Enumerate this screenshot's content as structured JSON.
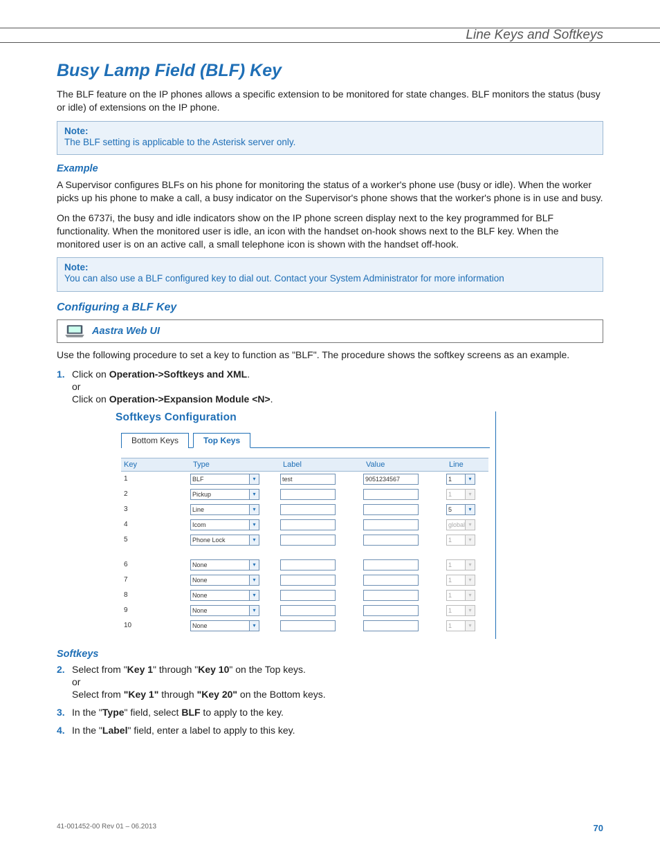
{
  "header": {
    "section": "Line Keys and Softkeys"
  },
  "title": "Busy Lamp Field (BLF) Key",
  "intro": "The BLF feature on the IP phones allows a specific extension to be monitored for state changes. BLF monitors the status (busy or idle) of extensions on the IP phone.",
  "note1": {
    "label": "Note:",
    "text": "The BLF setting is applicable to the Asterisk server only."
  },
  "example_h": "Example",
  "example_p1": "A Supervisor configures BLFs on his phone for monitoring the status of a worker's phone use (busy or idle). When the worker picks up his phone to make a call, a busy indicator on the Supervisor's phone shows that the worker's phone is in use and busy.",
  "example_p2": "On the 6737i, the busy and idle indicators show on the IP phone screen display next to the key programmed for BLF functionality. When the monitored user is idle, an icon with the handset on-hook shows next to the BLF key. When the monitored user is on an active call, a small telephone icon is shown with the handset off-hook.",
  "note2": {
    "label": "Note:",
    "text": "You can also use a BLF configured key to dial out. Contact your System Administrator for more information"
  },
  "config_h": "Configuring a BLF Key",
  "webui_label": "Aastra Web UI",
  "proc_intro": "Use the following procedure to set a key to function as \"BLF\". The procedure shows the softkey screens as an example.",
  "step1": {
    "prefix": "Click on ",
    "b1": "Operation->Softkeys and XML",
    "suffix1": ".",
    "or": "or",
    "prefix2": "Click on ",
    "b2": "Operation->Expansion Module <N>",
    "suffix2": "."
  },
  "screenshot": {
    "title": "Softkeys Configuration",
    "tabs": {
      "inactive": "Bottom Keys",
      "active": "Top Keys"
    },
    "columns": [
      "Key",
      "Type",
      "Label",
      "Value",
      "Line"
    ],
    "rows": [
      {
        "key": "1",
        "type": "BLF",
        "label": "test",
        "value": "9051234567",
        "line": "1",
        "line_disabled": false
      },
      {
        "key": "2",
        "type": "Pickup",
        "label": "",
        "value": "",
        "line": "1",
        "line_disabled": true
      },
      {
        "key": "3",
        "type": "Line",
        "label": "",
        "value": "",
        "line": "5",
        "line_disabled": false
      },
      {
        "key": "4",
        "type": "Icom",
        "label": "",
        "value": "",
        "line": "global",
        "line_disabled": true
      },
      {
        "key": "5",
        "type": "Phone Lock",
        "label": "",
        "value": "",
        "line": "1",
        "line_disabled": true
      },
      {
        "key": "6",
        "type": "None",
        "label": "",
        "value": "",
        "line": "1",
        "line_disabled": true
      },
      {
        "key": "7",
        "type": "None",
        "label": "",
        "value": "",
        "line": "1",
        "line_disabled": true
      },
      {
        "key": "8",
        "type": "None",
        "label": "",
        "value": "",
        "line": "1",
        "line_disabled": true
      },
      {
        "key": "9",
        "type": "None",
        "label": "",
        "value": "",
        "line": "1",
        "line_disabled": true
      },
      {
        "key": "10",
        "type": "None",
        "label": "",
        "value": "",
        "line": "1",
        "line_disabled": true
      }
    ]
  },
  "softkeys_h": "Softkeys",
  "step2": {
    "t1": "Select from \"",
    "b1": "Key 1",
    "t2": "\" through \"",
    "b2": "Key 10",
    "t3": "\" on the Top keys.",
    "or": "or",
    "t4": "Select from ",
    "b3": "\"Key 1\"",
    "t5": " through ",
    "b4": "\"Key 20\"",
    "t6": " on the Bottom keys."
  },
  "step3": {
    "t1": "In the \"",
    "b1": "Type",
    "t2": "\" field, select ",
    "b2": "BLF",
    "t3": " to apply to the key."
  },
  "step4": {
    "t1": "In the \"",
    "b1": "Label",
    "t2": "\" field, enter a label to apply to this key."
  },
  "footer": {
    "doc": "41-001452-00 Rev 01 – 06.2013",
    "page": "70"
  }
}
